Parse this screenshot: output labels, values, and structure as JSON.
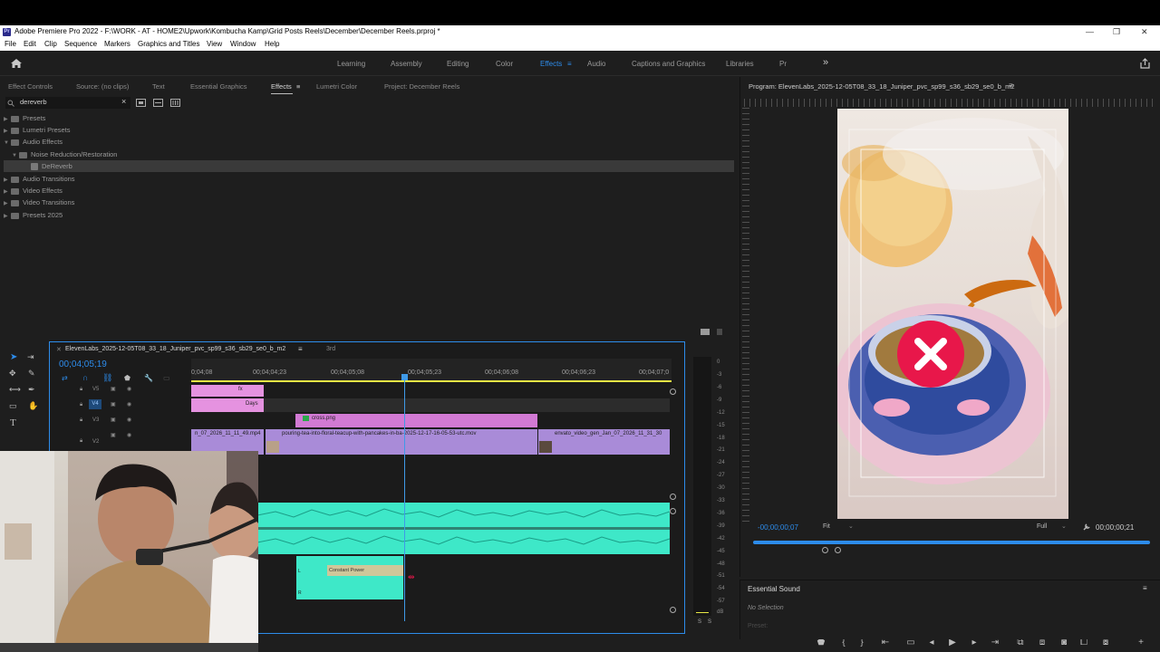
{
  "window": {
    "title": "Adobe Premiere Pro 2022 - F:\\WORK - AT - HOME2\\Upwork\\Kombucha Kamp\\Grid Posts Reels\\December\\December Reels.prproj *",
    "app_icon": "Pr",
    "controls": [
      "—",
      "❐",
      "✕"
    ]
  },
  "menu": [
    "File",
    "Edit",
    "Clip",
    "Sequence",
    "Markers",
    "Graphics and Titles",
    "View",
    "Window",
    "Help"
  ],
  "workspaces": [
    "Learning",
    "Assembly",
    "Editing",
    "Color",
    "Effects",
    "Audio",
    "Captions and Graphics",
    "Libraries",
    "Pr"
  ],
  "workspace_active": "Effects",
  "workspace_more": "»",
  "effects_panel": {
    "tabs": [
      "Effect Controls",
      "Source: (no clips)",
      "Text",
      "Essential Graphics",
      "Effects",
      "Lumetri Color",
      "Project: December Reels"
    ],
    "active_tab": "Effects",
    "search_value": "dereverb",
    "tree": [
      {
        "label": "Presets",
        "level": 0
      },
      {
        "label": "Lumetri Presets",
        "level": 0
      },
      {
        "label": "Audio Effects",
        "level": 0,
        "open": true
      },
      {
        "label": "Noise Reduction/Restoration",
        "level": 1,
        "open": true
      },
      {
        "label": "DeReverb",
        "level": 2,
        "selected": true
      },
      {
        "label": "Audio Transitions",
        "level": 0
      },
      {
        "label": "Video Effects",
        "level": 0
      },
      {
        "label": "Video Transitions",
        "level": 0
      },
      {
        "label": "Presets 2025",
        "level": 0
      }
    ]
  },
  "program_monitor": {
    "title": "Program: ElevenLabs_2025-12-05T08_33_18_Juniper_pvc_sp99_s36_sb29_se0_b_m2",
    "timecode_left": "-00;00;00;07",
    "fit": "Fit",
    "quality": "Full",
    "timecode_right": "00;00;00;21"
  },
  "essential_sound": {
    "title": "Essential Sound",
    "no_selection": "No Selection",
    "preset": "Preset:"
  },
  "timeline": {
    "tabs": [
      "ElevenLabs_2025-12-05T08_33_18_Juniper_pvc_sp99_s36_sb29_se0_b_m2",
      "3rd"
    ],
    "timecode": "00;04;05;19",
    "ruler": [
      "0;04;08",
      "00;04;04;23",
      "00;04;05;08",
      "00;04;05;23",
      "00;04;06;08",
      "00;04;06;23",
      "00;04;07;0"
    ],
    "tracks": [
      "V5",
      "V4",
      "V3",
      "V2"
    ],
    "clips": {
      "v5": "fx",
      "v4": "Days",
      "v3": "cross.png",
      "v2a": "n_07_2026_11_11_49.mp4",
      "v2b": "pouring-tea-into-floral-teacup-with-pancakes-in-ba-2025-12-17-16-05-53-utc.mov",
      "v2c": "envato_video_gen_Jan_07_2026_11_31_30",
      "audio_fx": "Constant Power"
    },
    "audio_channels": [
      "L",
      "R"
    ],
    "meter_labels": [
      "0",
      "-3",
      "-6",
      "-9",
      "-12",
      "-15",
      "-18",
      "-21",
      "-24",
      "-27",
      "-30",
      "-33",
      "-36",
      "-39",
      "-42",
      "-45",
      "-48",
      "-51",
      "-54",
      "-57",
      "dB"
    ],
    "meter_solo": [
      "S",
      "S"
    ]
  },
  "colors": {
    "accent": "#2d8ceb",
    "pink_clip": "#e592e0",
    "magenta_clip": "#d27ad4",
    "purple_clip": "#a98bd8",
    "audio_wave": "#3ee8c8",
    "fx_red": "#e8174a"
  }
}
